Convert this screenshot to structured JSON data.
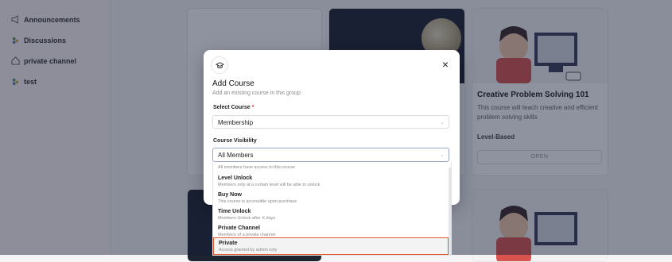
{
  "sidebar": {
    "items": [
      {
        "label": "Announcements",
        "icon": "megaphone-icon"
      },
      {
        "label": "Discussions",
        "icon": "people-icon"
      },
      {
        "label": "private channel",
        "icon": "home-icon"
      },
      {
        "label": "test",
        "icon": "people-icon"
      }
    ]
  },
  "courses": {
    "card_right": {
      "title": "Creative Problem Solving 101",
      "description": "This course will teach creative and efficient problem solving skills",
      "level": "Level-Based",
      "button": "OPEN"
    }
  },
  "modal": {
    "title": "Add Course",
    "subtitle": "Add an existing course in this group",
    "close": "×",
    "select_course": {
      "label": "Select Course",
      "required_mark": "*",
      "value": "Membership"
    },
    "visibility": {
      "label": "Course Visibility",
      "value": "All Members",
      "hint": "All members have access to this course",
      "options": [
        {
          "title": "Level Unlock",
          "desc": "Members only at a certain level will be able to unlock"
        },
        {
          "title": "Buy Now",
          "desc": "This course is accessible upon purchase"
        },
        {
          "title": "Time Unlock",
          "desc": "Members Unlock after X days"
        },
        {
          "title": "Private Channel",
          "desc": "Members of a private channel"
        },
        {
          "title": "Private",
          "desc": "Access granted by admin only",
          "highlighted": true
        }
      ]
    }
  },
  "colors": {
    "highlight_border": "#e2582a",
    "required": "#e0323a",
    "overlay": "#141e37"
  }
}
